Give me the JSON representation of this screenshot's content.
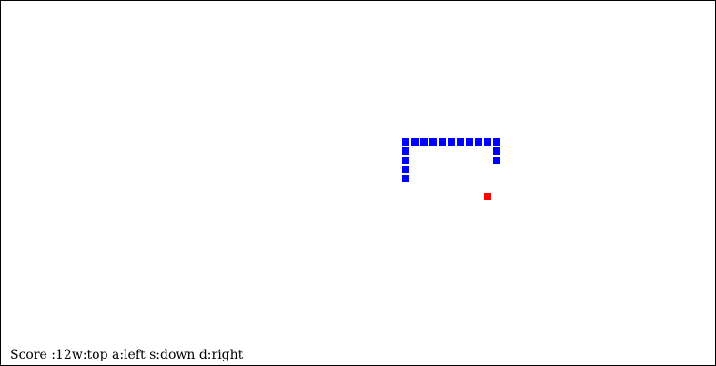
{
  "game": {
    "grid_columns": 78,
    "grid_rows": 40,
    "colors": {
      "snake": "#0000ff",
      "food": "#ff0000",
      "background": "#ffffff",
      "border": "#000000"
    },
    "snake": [
      [
        44,
        19
      ],
      [
        44,
        18
      ],
      [
        44,
        17
      ],
      [
        44,
        16
      ],
      [
        44,
        15
      ],
      [
        45,
        15
      ],
      [
        46,
        15
      ],
      [
        47,
        15
      ],
      [
        48,
        15
      ],
      [
        49,
        15
      ],
      [
        50,
        15
      ],
      [
        51,
        15
      ],
      [
        52,
        15
      ],
      [
        53,
        15
      ],
      [
        54,
        15
      ],
      [
        54,
        16
      ],
      [
        54,
        17
      ]
    ],
    "food": [
      53,
      21
    ]
  },
  "status": {
    "score_label": "Score :",
    "score_value": "12",
    "controls_text": "w:top a:left s:down d:right"
  }
}
